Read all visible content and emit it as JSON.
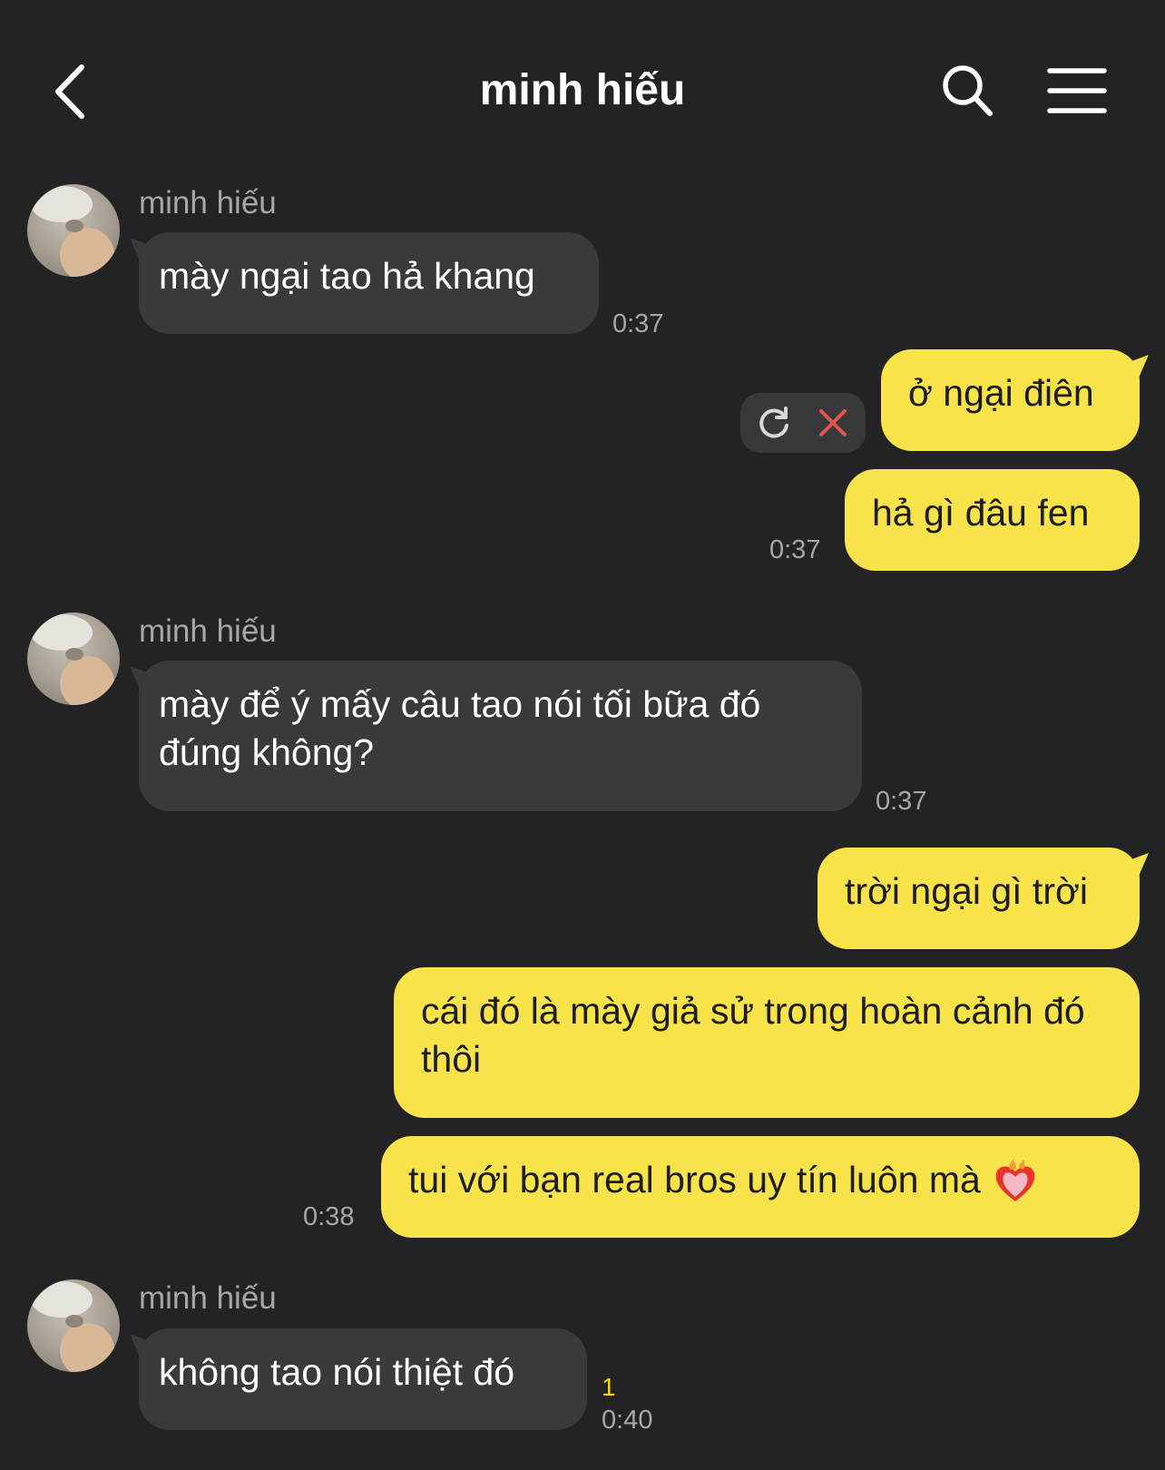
{
  "header": {
    "title": "minh hiếu",
    "back_icon": "chevron-left-icon",
    "search_icon": "search-icon",
    "menu_icon": "hamburger-menu-icon"
  },
  "colors": {
    "background": "#232325",
    "incoming_bubble": "#3a3a3c",
    "outgoing_bubble": "#f8e34b",
    "unread_count": "#f5d800",
    "cancel_x": "#e0564f"
  },
  "messages": [
    {
      "direction": "in",
      "sender": "minh hiếu",
      "text": "mày ngại tao hả khang",
      "time": "0:37"
    },
    {
      "direction": "out",
      "text": "ở ngại điên",
      "status": "failed"
    },
    {
      "direction": "out",
      "text": "hả gì đâu fen",
      "time": "0:37"
    },
    {
      "direction": "in",
      "sender": "minh hiếu",
      "text": "mày để ý mấy câu tao nói tối bữa đó đúng không?",
      "time": "0:37"
    },
    {
      "direction": "out",
      "text": "trời ngại gì trời"
    },
    {
      "direction": "out",
      "text": "cái đó là mày giả sử trong hoàn cảnh đó thôi"
    },
    {
      "direction": "out",
      "text": "tui với bạn real bros uy tín luôn mà",
      "emoji": "heart-on-fire-emoji",
      "time": "0:38"
    },
    {
      "direction": "in",
      "sender": "minh hiếu",
      "text": "không tao nói thiệt đó",
      "unread": "1",
      "time": "0:40"
    }
  ],
  "failed_actions": {
    "retry_icon": "retry-icon",
    "cancel_icon": "close-icon"
  }
}
